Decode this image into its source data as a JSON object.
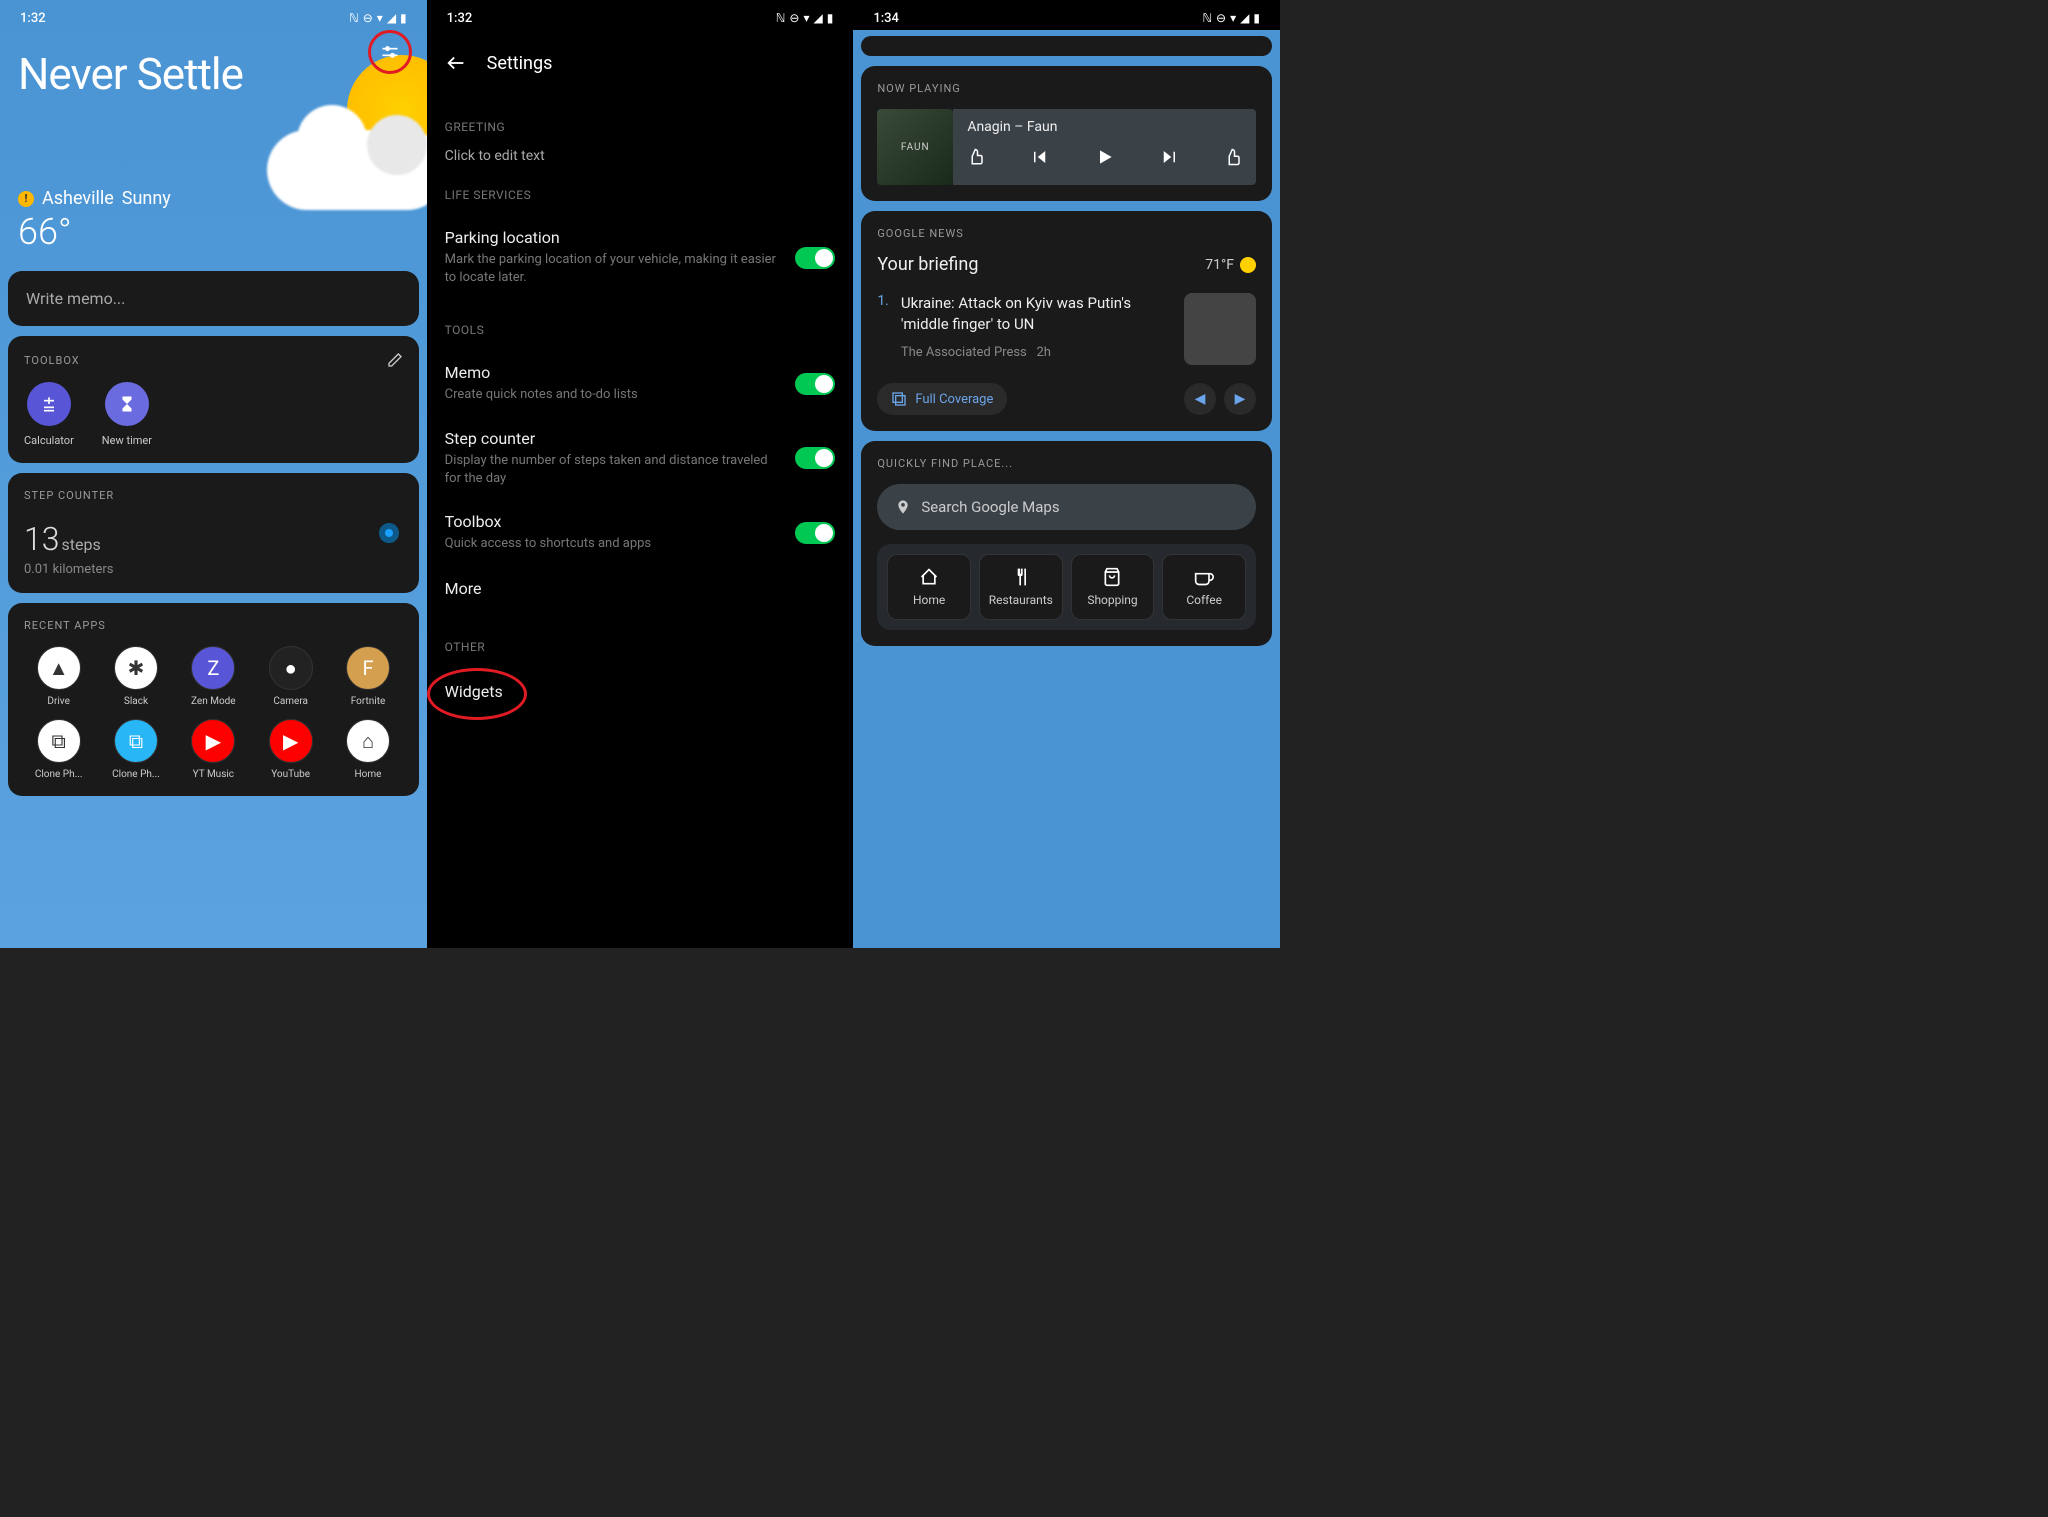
{
  "status": {
    "time1": "1:32",
    "time2": "1:32",
    "time3": "1:34"
  },
  "screen1": {
    "greeting": "Never Settle",
    "location": "Asheville",
    "condition": "Sunny",
    "temp": "66°",
    "memo_placeholder": "Write memo...",
    "toolbox_label": "TOOLBOX",
    "tools": {
      "calc": "Calculator",
      "timer": "New timer"
    },
    "step_label": "STEP COUNTER",
    "steps_num": "13",
    "steps_unit": "steps",
    "distance": "0.01 kilometers",
    "recent_label": "RECENT APPS",
    "apps": [
      {
        "name": "Drive",
        "color": "#fff"
      },
      {
        "name": "Slack",
        "color": "#fff"
      },
      {
        "name": "Zen Mode",
        "color": "#5856d6"
      },
      {
        "name": "Camera",
        "color": "#222"
      },
      {
        "name": "Fortnite",
        "color": "#d4a050"
      },
      {
        "name": "Clone Ph...",
        "color": "#fff"
      },
      {
        "name": "Clone Ph...",
        "color": "#29b6f6"
      },
      {
        "name": "YT Music",
        "color": "#ff0000"
      },
      {
        "name": "YouTube",
        "color": "#ff0000"
      },
      {
        "name": "Home",
        "color": "#fff"
      }
    ]
  },
  "screen2": {
    "title": "Settings",
    "sections": {
      "greeting_label": "GREETING",
      "greeting_text": "Click to edit text",
      "life_label": "LIFE SERVICES",
      "tools_label": "TOOLS",
      "other_label": "OTHER"
    },
    "rows": {
      "parking_title": "Parking location",
      "parking_desc": "Mark the parking location of your vehicle, making it easier to locate later.",
      "memo_title": "Memo",
      "memo_desc": "Create quick notes and to-do lists",
      "step_title": "Step counter",
      "step_desc": "Display the number of steps taken and distance traveled for the day",
      "toolbox_title": "Toolbox",
      "toolbox_desc": "Quick access to shortcuts and apps",
      "more": "More",
      "widgets": "Widgets"
    }
  },
  "screen3": {
    "now_playing_label": "NOW PLAYING",
    "album_brand": "FAUN",
    "track": "Anagin – Faun",
    "news_label": "GOOGLE NEWS",
    "briefing": "Your briefing",
    "briefing_temp": "71°F",
    "news_num": "1.",
    "news_headline": "Ukraine: Attack on Kyiv was Putin's 'middle finger' to UN",
    "news_source": "The Associated Press",
    "news_time": "2h",
    "full_coverage": "Full Coverage",
    "find_place_label": "QUICKLY FIND PLACE...",
    "maps_placeholder": "Search Google Maps",
    "places": {
      "home": "Home",
      "restaurants": "Restaurants",
      "shopping": "Shopping",
      "coffee": "Coffee"
    }
  }
}
